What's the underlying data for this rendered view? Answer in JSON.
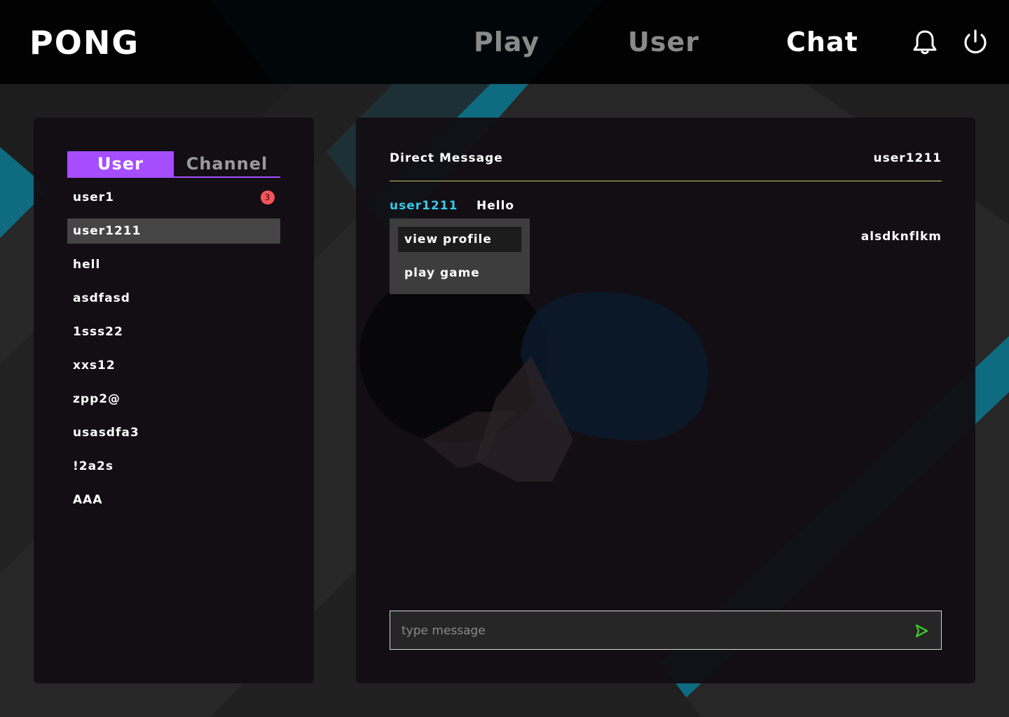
{
  "header": {
    "logo": "PONG",
    "nav": [
      {
        "label": "Play",
        "active": false
      },
      {
        "label": "User",
        "active": false
      },
      {
        "label": "Chat",
        "active": true
      }
    ],
    "icons": [
      "bell-icon",
      "power-icon"
    ]
  },
  "sidebar": {
    "tabs": [
      {
        "label": "User",
        "active": true
      },
      {
        "label": "Channel",
        "active": false
      }
    ],
    "users": [
      {
        "name": "user1",
        "badge": "3",
        "selected": false
      },
      {
        "name": "user1211",
        "selected": true
      },
      {
        "name": "hell"
      },
      {
        "name": "asdfasd"
      },
      {
        "name": "1sss22"
      },
      {
        "name": "xxs12"
      },
      {
        "name": "zpp2@"
      },
      {
        "name": "usasdfa3"
      },
      {
        "name": "!2a2s"
      },
      {
        "name": "AAA"
      }
    ]
  },
  "chat": {
    "title": "Direct Message",
    "target": "user1211",
    "messages": [
      {
        "sender": "user1211",
        "text": "Hello",
        "side": "left"
      },
      {
        "text": "alsdknflkm",
        "side": "right"
      }
    ],
    "context_menu": {
      "items": [
        {
          "label": "view profile",
          "hover": true
        },
        {
          "label": "play game",
          "hover": false
        }
      ]
    },
    "input": {
      "placeholder": "type message",
      "value": ""
    },
    "send_icon": "send-icon"
  },
  "colors": {
    "accent_purple": "#a64dff",
    "teal": "#0e6b80",
    "sender_cyan": "#38c9e8",
    "badge_red": "#f2545b",
    "divider_olive": "#c6c95a",
    "send_green": "#3ad12a"
  }
}
